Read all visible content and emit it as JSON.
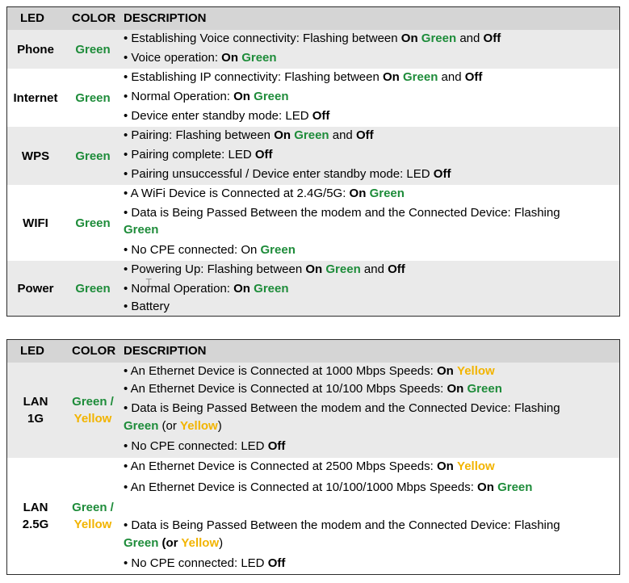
{
  "table1": {
    "headers": {
      "led": "LED",
      "color": "COLOR",
      "description": "DESCRIPTION"
    },
    "rows": {
      "phone": {
        "led": "Phone",
        "color": "Green",
        "d1": {
          "a": "• Establishing Voice connectivity: Flashing between ",
          "b": "On",
          "c": "Green",
          "d": " and ",
          "e": "Off"
        },
        "d2": {
          "a": "• Voice operation: ",
          "b": "On",
          "c": "Green"
        }
      },
      "internet": {
        "led": "Internet",
        "color": "Green",
        "d1": {
          "a": "• Establishing IP connectivity: Flashing between ",
          "b": "On",
          "c": "Green",
          "d": " and ",
          "e": "Off"
        },
        "d2": {
          "a": "• Normal Operation: ",
          "b": "On",
          "c": "Green"
        },
        "d3": {
          "a": "• Device enter standby mode: LED ",
          "b": "Off"
        }
      },
      "wps": {
        "led": "WPS",
        "color": "Green",
        "d1": {
          "a": "• Pairing: Flashing between ",
          "b": "On",
          "c": "Green",
          "d": " and ",
          "e": "Off"
        },
        "d2": {
          "a": "• Pairing complete: LED ",
          "b": "Off"
        },
        "d3": {
          "a": "• Pairing unsuccessful / Device enter standby mode: LED ",
          "b": "Off"
        }
      },
      "wifi": {
        "led": "WIFI",
        "color": "Green",
        "d1": {
          "a": "• A WiFi Device is Connected at 2.4G/5G: ",
          "b": "On",
          "c": "Green"
        },
        "d2": {
          "a": "• Data is Being Passed Between the modem and the Connected Device: Flashing",
          "b": "Green"
        },
        "d3": {
          "a": "• No CPE connected: On ",
          "b": "Green"
        }
      },
      "power": {
        "led": "Power",
        "color": "Green",
        "d1": {
          "a": "• Powering Up: Flashing between ",
          "b": "On",
          "c": "Green",
          "d": " and ",
          "e": "Off"
        },
        "d2": {
          "a": "• Normal Operation: ",
          "b": "On",
          "c": "Green"
        },
        "d3": {
          "a": "• Battery"
        }
      }
    }
  },
  "table2": {
    "headers": {
      "led": "LED",
      "color": "COLOR",
      "description": "DESCRIPTION"
    },
    "rows": {
      "lan1g": {
        "led1": "LAN",
        "led2": "1G",
        "color1": "Green /",
        "color2": "Yellow",
        "d1": {
          "a": "• An Ethernet Device is Connected at 1000 Mbps Speeds: ",
          "b": "On",
          "c": "Yellow"
        },
        "d2": {
          "a": "• An Ethernet Device is Connected at 10/100 Mbps Speeds: ",
          "b": "On",
          "c": "Green"
        },
        "d3": {
          "a": "• Data is Being Passed Between the modem and the Connected Device: Flashing"
        },
        "d4": {
          "a": "Green",
          "b": " (or ",
          "c": "Yellow",
          "d": ")"
        },
        "d5": {
          "a": "• No CPE connected: LED ",
          "b": "Off"
        }
      },
      "lan25g": {
        "led1": "LAN",
        "led2": "2.5G",
        "color1": "Green /",
        "color2": "Yellow",
        "d1": {
          "a": "• An Ethernet Device is Connected at 2500 Mbps Speeds: ",
          "b": "On",
          "c": "Yellow"
        },
        "d2": {
          "a": "• An Ethernet Device is Connected at 10/100/1000 Mbps Speeds: ",
          "b": "On",
          "c": "Green"
        },
        "d3": {
          "a": "• Data is Being Passed Between the modem and the Connected Device: Flashing"
        },
        "d4": {
          "a": "Green",
          "b": " (or ",
          "c": "Yellow",
          "d": ")"
        },
        "d5": {
          "a": "• No CPE connected: LED ",
          "b": "Off"
        }
      }
    }
  },
  "cursor_icon": "i-beam-cursor-icon",
  "colors": {
    "green": "#1e8c3a",
    "yellow": "#f2b400",
    "header_bg": "#d5d5d5",
    "row_shade": "#eaeaea"
  }
}
